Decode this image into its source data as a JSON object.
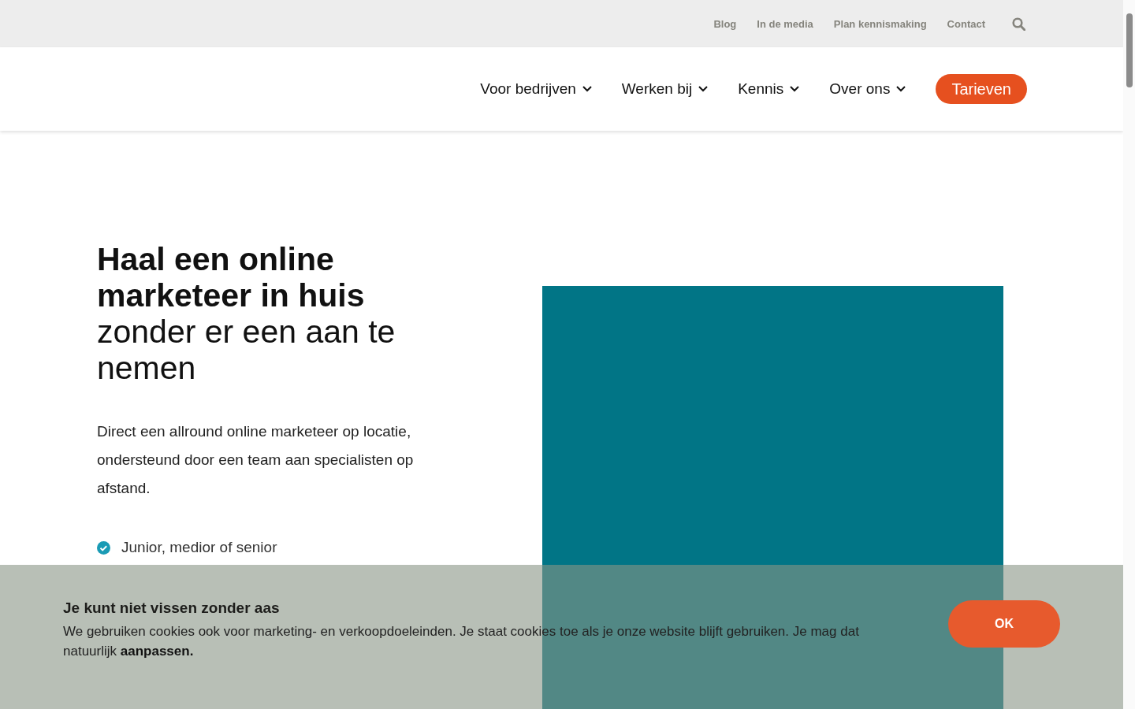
{
  "top_bar": {
    "links": [
      "Blog",
      "In de media",
      "Plan kennismaking",
      "Contact"
    ]
  },
  "nav": {
    "items": [
      {
        "label": "Voor bedrijven"
      },
      {
        "label": "Werken bij"
      },
      {
        "label": "Kennis"
      },
      {
        "label": "Over ons"
      }
    ],
    "cta": "Tarieven"
  },
  "hero": {
    "heading": "**Haal een online marketeer in huis** zonder er een aan te nemen",
    "intro": "Direct een allround online marketeer op locatie, ondersteund door een team aan specialisten op afstand.",
    "checklist": [
      "Junior, medior of senior"
    ]
  },
  "cookie_banner": {
    "title": "Je kunt niet vissen zonder aas",
    "text": "We gebruiken cookies ook voor marketing- en verkoopdoeleinden. Je staat cookies toe als je onze website blijft gebruiken. Je mag dat natuurlijk",
    "link": "aanpassen.",
    "button": "OK"
  }
}
